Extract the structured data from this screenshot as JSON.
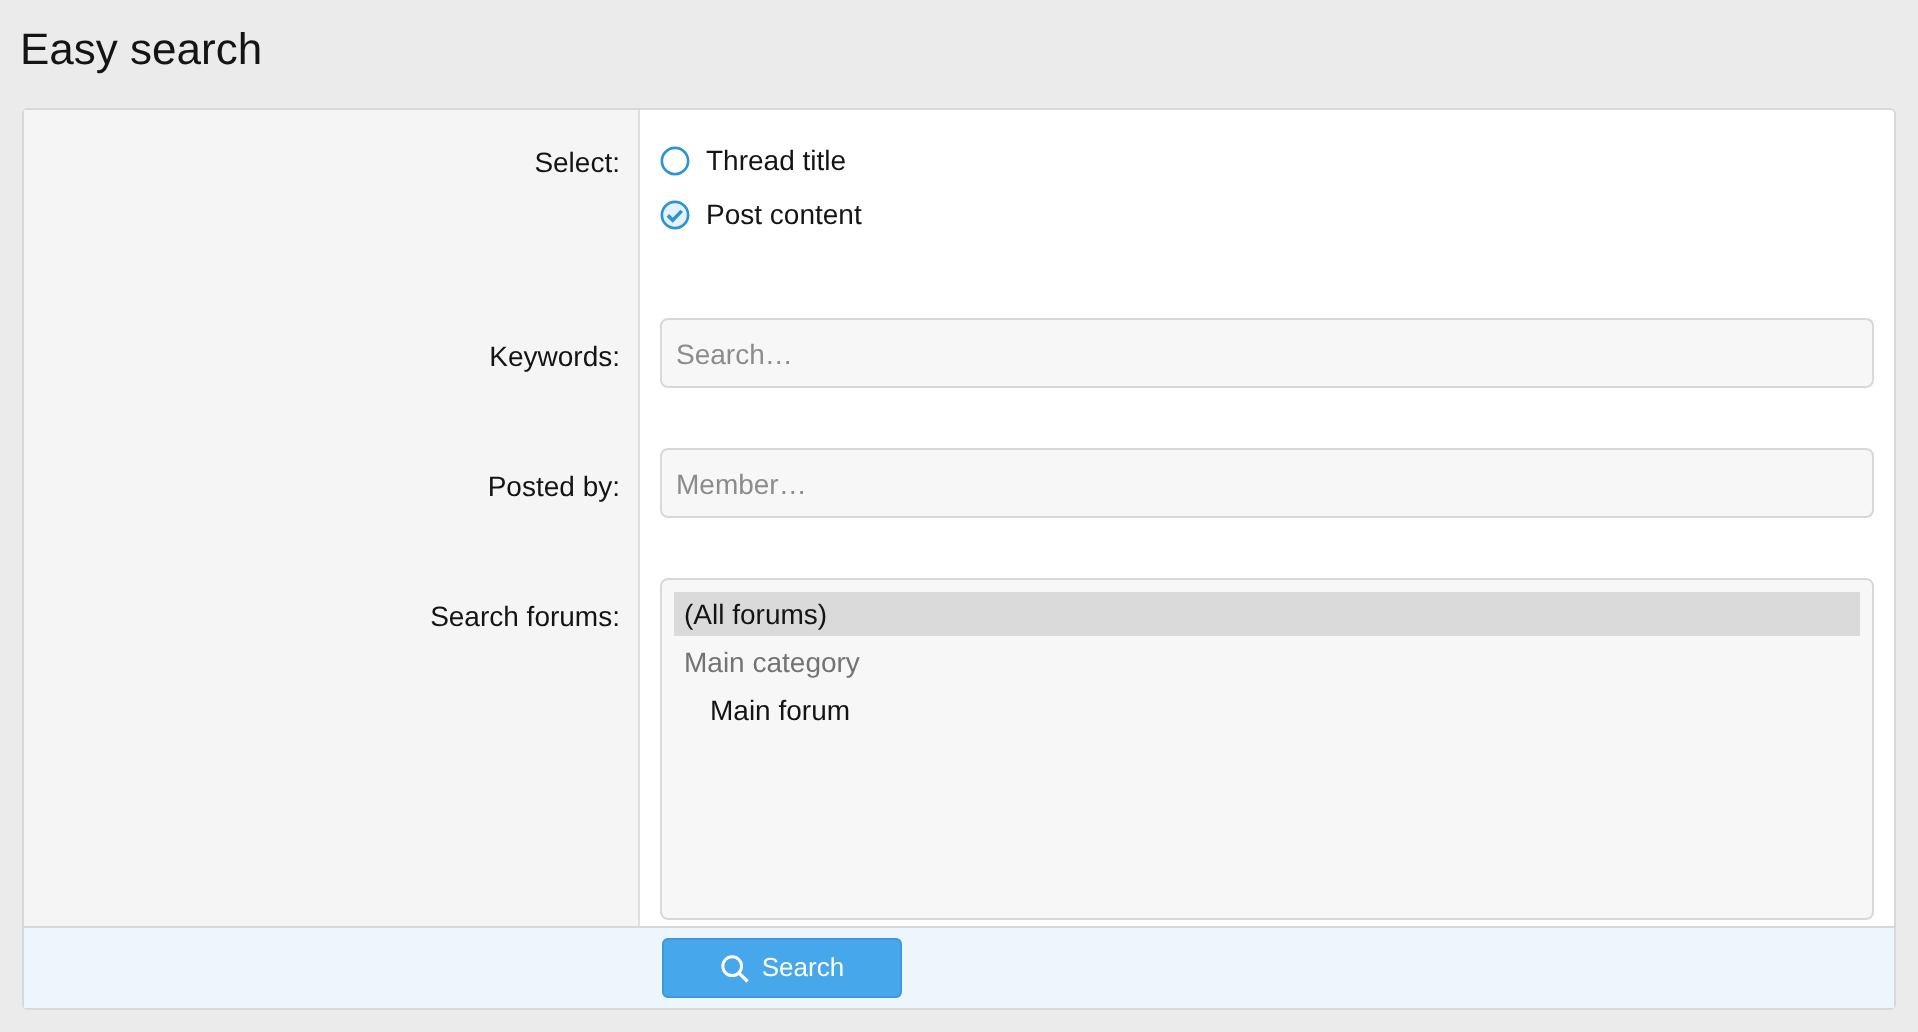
{
  "title": "Easy search",
  "select": {
    "label": "Select:",
    "options": [
      {
        "label": "Thread title",
        "selected": false
      },
      {
        "label": "Post content",
        "selected": true
      }
    ]
  },
  "keywords": {
    "label": "Keywords:",
    "placeholder": "Search…"
  },
  "posted_by": {
    "label": "Posted by:",
    "placeholder": "Member…"
  },
  "forums": {
    "label": "Search forums:",
    "items": [
      {
        "label": "(All forums)",
        "kind": "option",
        "selected": true
      },
      {
        "label": "Main category",
        "kind": "category",
        "selected": false,
        "children": [
          {
            "label": "Main forum",
            "kind": "option",
            "selected": false
          }
        ]
      }
    ]
  },
  "submit": {
    "label": "Search"
  }
}
